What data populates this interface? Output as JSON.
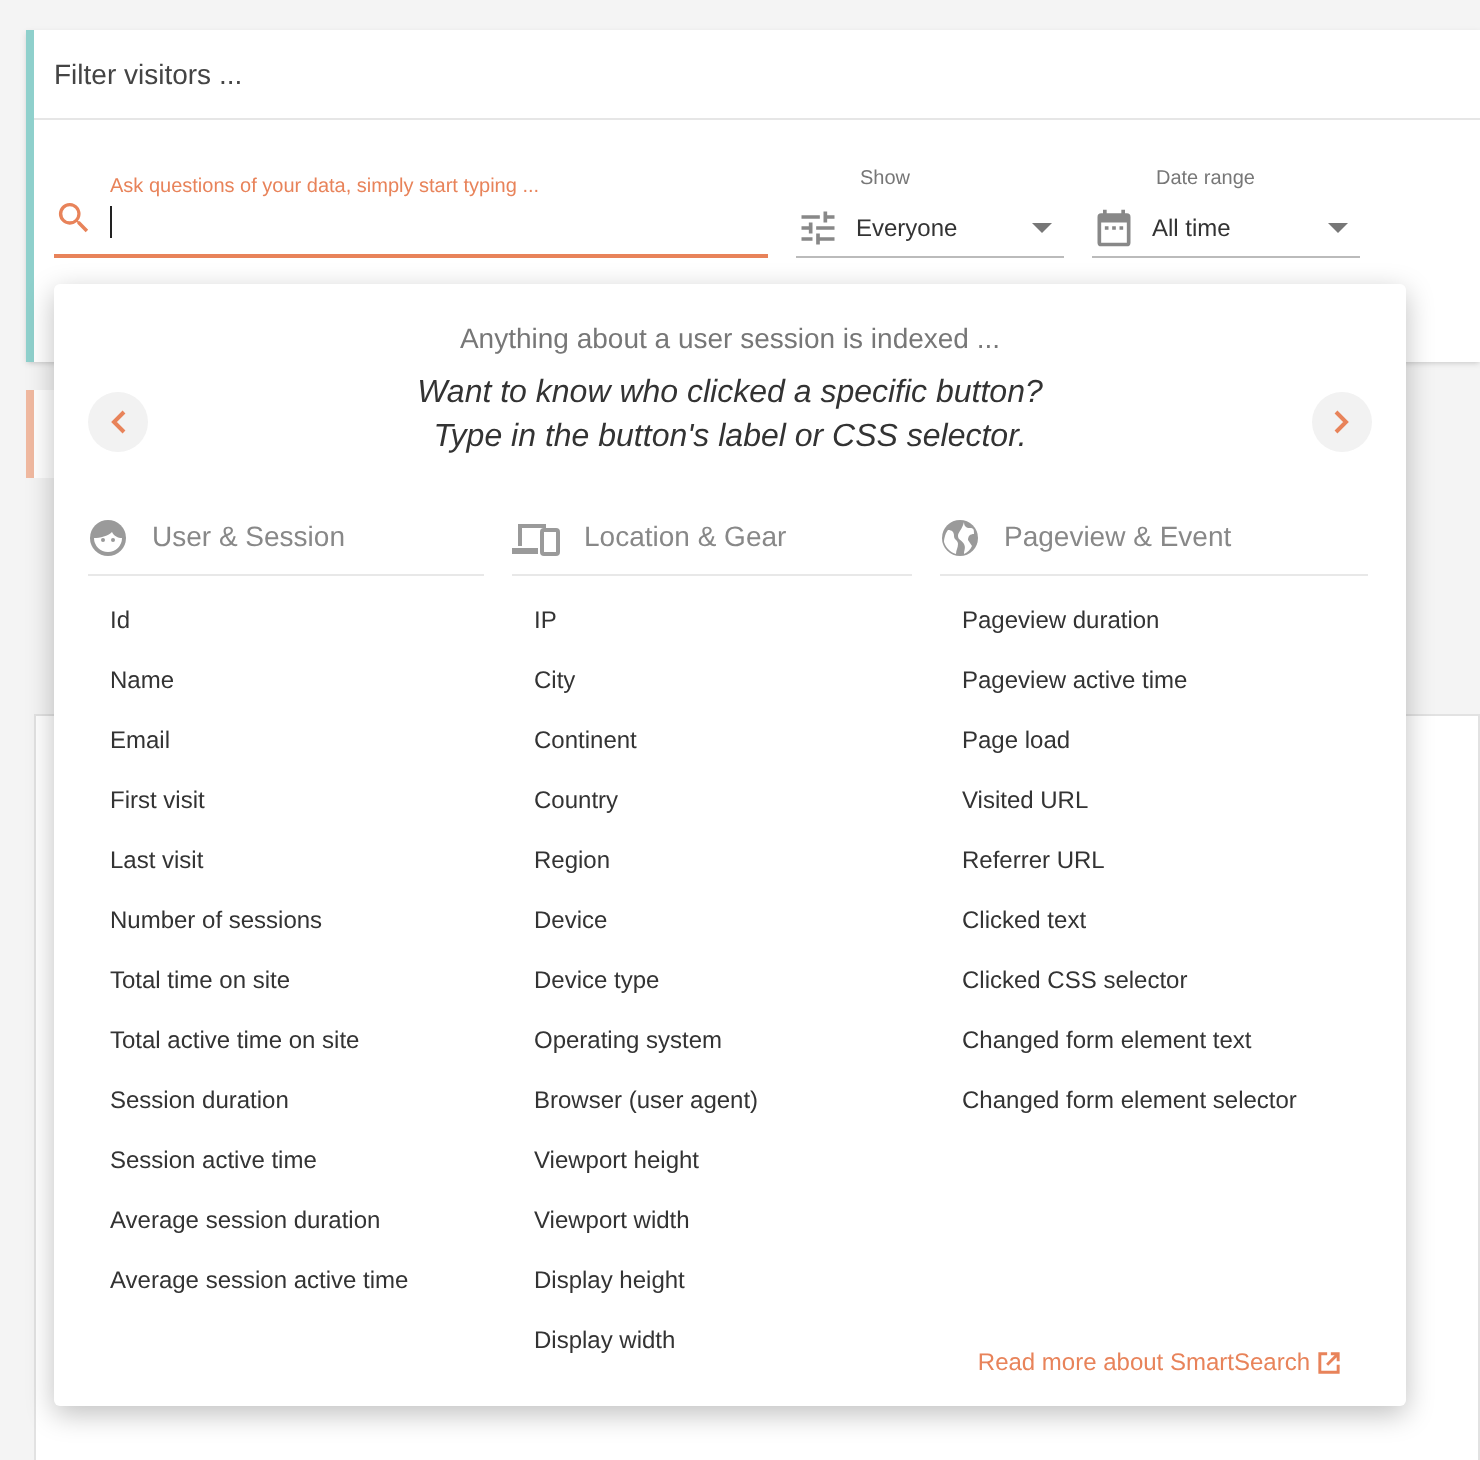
{
  "filter": {
    "title": "Filter visitors ..."
  },
  "search": {
    "label": "Ask questions of your data, simply start typing ...",
    "focused": true
  },
  "show": {
    "label": "Show",
    "value": "Everyone"
  },
  "date_range": {
    "label": "Date range",
    "value": "All time"
  },
  "suggestions": {
    "intro": "Anything about a user session is indexed ...",
    "tip_lines": [
      "Want to know who clicked a specific button?",
      "Type in the button's label or CSS selector."
    ],
    "columns": [
      {
        "kind": "user",
        "title": "User & Session",
        "items": [
          "Id",
          "Name",
          "Email",
          "First visit",
          "Last visit",
          "Number of sessions",
          "Total time on site",
          "Total active time on site",
          "Session duration",
          "Session active time",
          "Average session duration",
          "Average session active time"
        ]
      },
      {
        "kind": "location",
        "title": "Location & Gear",
        "items": [
          "IP",
          "City",
          "Continent",
          "Country",
          "Region",
          "Device",
          "Device type",
          "Operating system",
          "Browser (user agent)",
          "Viewport height",
          "Viewport width",
          "Display height",
          "Display width"
        ]
      },
      {
        "kind": "pageview",
        "title": "Pageview & Event",
        "items": [
          "Pageview duration",
          "Pageview active time",
          "Page load",
          "Visited URL",
          "Referrer URL",
          "Clicked text",
          "Clicked CSS selector",
          "Changed form element text",
          "Changed form element selector"
        ]
      }
    ],
    "link": "Read more about SmartSearch"
  }
}
